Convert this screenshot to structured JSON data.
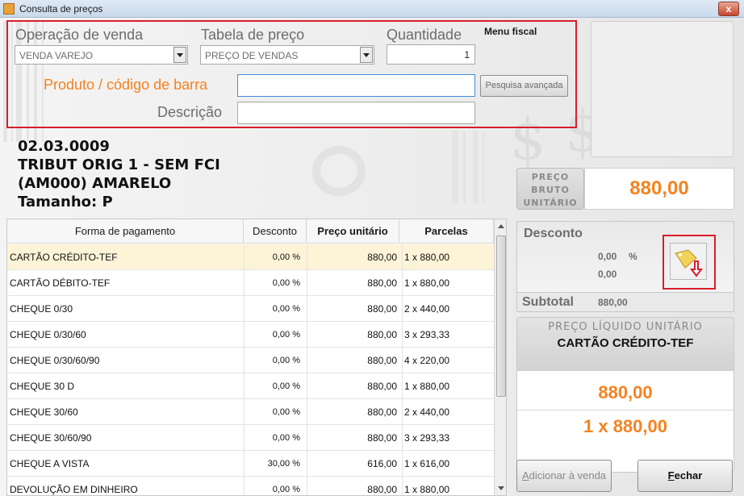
{
  "window": {
    "title": "Consulta de preços",
    "close_label": "x"
  },
  "form": {
    "operacao_label": "Operação de venda",
    "operacao_value": "VENDA VAREJO",
    "tabela_label": "Tabela de preço",
    "tabela_value": "PREÇO DE VENDAS",
    "quantidade_label": "Quantidade",
    "quantidade_value": "1",
    "menu_fiscal_label": "Menu fiscal",
    "produto_label": "Produto / código de barra",
    "produto_value": "",
    "pesquisa_label": "Pesquisa avançada",
    "descricao_label": "Descrição",
    "descricao_value": ""
  },
  "product": {
    "code": "02.03.0009",
    "line1": "TRIBUT ORIG 1 - SEM FCI",
    "line2": "(AM000) AMARELO",
    "line3": "Tamanho: P"
  },
  "gross_price": {
    "label_line1": "PREÇO",
    "label_line2": "BRUTO",
    "label_line3": "UNITÁRIO",
    "value": "880,00"
  },
  "grid": {
    "headers": [
      "Forma de pagamento",
      "Desconto",
      "Preço unitário",
      "Parcelas"
    ],
    "rows": [
      {
        "forma": "CARTÃO CRÉDITO-TEF",
        "desconto": "0,00 %",
        "preco": "880,00",
        "parcelas": "1 x 880,00"
      },
      {
        "forma": "CARTÃO DÉBITO-TEF",
        "desconto": "0,00 %",
        "preco": "880,00",
        "parcelas": "1 x 880,00"
      },
      {
        "forma": "CHEQUE 0/30",
        "desconto": "0,00 %",
        "preco": "880,00",
        "parcelas": "2 x 440,00"
      },
      {
        "forma": "CHEQUE 0/30/60",
        "desconto": "0,00 %",
        "preco": "880,00",
        "parcelas": "3 x 293,33"
      },
      {
        "forma": "CHEQUE 0/30/60/90",
        "desconto": "0,00 %",
        "preco": "880,00",
        "parcelas": "4 x 220,00"
      },
      {
        "forma": "CHEQUE 30 D",
        "desconto": "0,00 %",
        "preco": "880,00",
        "parcelas": "1 x 880,00"
      },
      {
        "forma": "CHEQUE 30/60",
        "desconto": "0,00 %",
        "preco": "880,00",
        "parcelas": "2 x 440,00"
      },
      {
        "forma": "CHEQUE 30/60/90",
        "desconto": "0,00 %",
        "preco": "880,00",
        "parcelas": "3 x 293,33"
      },
      {
        "forma": "CHEQUE A VISTA",
        "desconto": "30,00 %",
        "preco": "616,00",
        "parcelas": "1 x 616,00"
      },
      {
        "forma": "DEVOLUÇÃO EM DINHEIRO",
        "desconto": "0,00 %",
        "preco": "880,00",
        "parcelas": "1 x 880,00"
      }
    ]
  },
  "discount": {
    "title": "Desconto",
    "percent": "0,00",
    "percent_sign": "%",
    "value": "0,00",
    "subtotal_label": "Subtotal",
    "subtotal_value": "880,00"
  },
  "net_price": {
    "title": "PREÇO LÍQUIDO UNITÁRIO",
    "payment": "CARTÃO CRÉDITO-TEF",
    "value": "880,00",
    "installments": "1 x 880,00"
  },
  "buttons": {
    "add_first": "A",
    "add_rest": "dicionar à venda",
    "close_first": "F",
    "close_rest": "echar"
  },
  "colors": {
    "accent_orange": "#f58220",
    "highlight_red": "#d81e2a",
    "selected_row": "#fdf3d7"
  }
}
